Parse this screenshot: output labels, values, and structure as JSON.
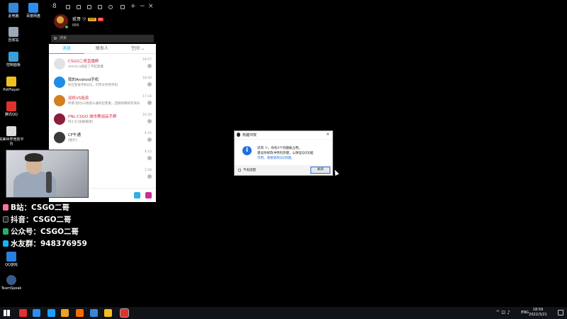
{
  "desktop": {
    "icons": [
      {
        "label": "此电脑",
        "color": "#3a86d8"
      },
      {
        "label": "百度网盘",
        "color": "#2f8cf2"
      },
      {
        "label": "回收站",
        "color": "#9aa8b8"
      },
      {
        "label": "控制面板",
        "color": "#3aa0d9"
      },
      {
        "label": "PotPlayer",
        "color": "#f0c020"
      },
      {
        "label": "腾讯QQ",
        "color": "#e03030"
      },
      {
        "label": "完美世界竞技平台",
        "color": "#dddddd"
      },
      {
        "label": "QQ游戏",
        "color": "#2a80e0"
      },
      {
        "label": "TeamSpeak",
        "color": "#3a5a8a"
      }
    ]
  },
  "qq": {
    "titlebar_num": "8",
    "profile": {
      "nickname": "贰哥 ツ",
      "badge_svip": "SVIP",
      "badge_level": "LV",
      "signature": "666"
    },
    "search_placeholder": "搜索",
    "tabs": {
      "messages": "消息",
      "contacts": "联系人",
      "space": "空间"
    },
    "conversations": [
      {
        "name": "CSGO二哥直播群",
        "preview": "merck:a发起了不起直播",
        "time": "18:57",
        "count": "",
        "red": true,
        "avatar_color": "#dfe3e8"
      },
      {
        "name": "我的Android手机",
        "preview": "你已登录手机QQ，可传文件到手机",
        "time": "18:49",
        "count": "",
        "red": false,
        "avatar_color": "#1f8ce6"
      },
      {
        "name": "双机VS投资",
        "preview": "阿萌 别付x2款第么通的拉客重，回顾很棒新年快乐",
        "time": "17:16",
        "count": "",
        "red": true,
        "avatar_color": "#d08020"
      },
      {
        "name": "PNL-CSGO 城市赛战品手群",
        "preview": "阿小七[总群邀请]",
        "time": "16:20",
        "count": "",
        "red": true,
        "avatar_color": "#8a1f3a"
      },
      {
        "name": "CF午通",
        "preview": "[图片]",
        "time": "4:55",
        "count": "",
        "red": false,
        "avatar_color": "#3a3a3a"
      },
      {
        "name": "",
        "preview": "",
        "time": "4:15",
        "count": "",
        "red": false,
        "avatar_color": "#e08830"
      },
      {
        "name": "",
        "preview": "",
        "time": "1:58",
        "count": "",
        "red": false,
        "avatar_color": "#c0c4ca"
      }
    ]
  },
  "social": [
    {
      "text": "B站：CSGO二哥",
      "icon_color": "#fb7299"
    },
    {
      "text": "抖音：CSGO二哥",
      "icon_color": "#222222"
    },
    {
      "text": "公众号：CSGO二哥",
      "icon_color": "#2aae67"
    },
    {
      "text": "水友群：948376959",
      "icon_color": "#12b7f5"
    }
  ],
  "popup": {
    "title": "热键冲突",
    "line1": "贰哥 ツ，你有2个热键被占用。",
    "line2": "建议你修改冲突的热键，以保证QQ功能",
    "line3": "可用。或者修改QQ热键。",
    "dont_remind": "不再提醒",
    "close_label": "关闭",
    "close_x": "×"
  },
  "taskbar": {
    "lang": "ENG",
    "time": "18:59",
    "date": "2022/3/21",
    "app_colors": [
      "#e03030",
      "#2f8cf2",
      "#1a9fff",
      "#f0a020",
      "#ff6a00",
      "#3a86d8",
      "#f0c020",
      "#e03030"
    ]
  }
}
